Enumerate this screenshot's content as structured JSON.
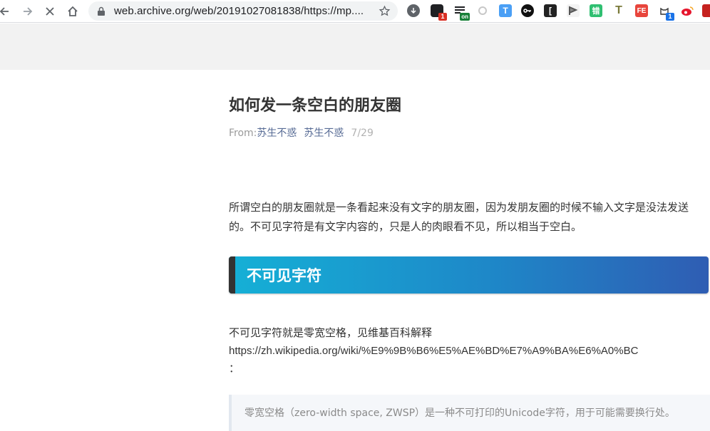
{
  "browser": {
    "url": "web.archive.org/web/20191027081838/https://mp....",
    "extensions": [
      {
        "name": "download",
        "color": "#5f6368"
      },
      {
        "name": "ext-badge-1",
        "color": "#202124",
        "badge": "1",
        "badge_color": "#d93025"
      },
      {
        "name": "ext-list-on",
        "color": "#202124",
        "badge": "on",
        "badge_color": "#188038"
      },
      {
        "name": "ext-gray",
        "color": "#bdbdbd"
      },
      {
        "name": "ext-T",
        "label": "T",
        "color": "#4a9ff5"
      },
      {
        "name": "ext-key",
        "color": "#111111"
      },
      {
        "name": "ext-bracket",
        "label": "[",
        "color": "#222222"
      },
      {
        "name": "ext-flag",
        "color": "#555555"
      },
      {
        "name": "ext-cuo",
        "label": "错",
        "color": "#2fbf71"
      },
      {
        "name": "ext-T2",
        "label": "T",
        "color": "#7a7a3a"
      },
      {
        "name": "ext-FE",
        "label": "FE",
        "color": "#e8453c"
      },
      {
        "name": "ext-cat",
        "color": "#ffffff",
        "badge": "1",
        "badge_color": "#1a73e8"
      },
      {
        "name": "ext-weibo",
        "color": "#e6162d"
      },
      {
        "name": "ext-red",
        "color": "#c5221f"
      }
    ]
  },
  "article": {
    "title": "如何发一条空白的朋友圈",
    "meta_from": "From:",
    "meta_from_author": "苏生不惑",
    "meta_author": "苏生不惑",
    "meta_date": "7/29",
    "para1": "所谓空白的朋友圈就是一条看起来没有文字的朋友圈，因为发朋友圈的时候不输入文字是没法发送的。不可见字符是有文字内容的，只是人的肉眼看不见，所以相当于空白。",
    "section_heading": "不可见字符",
    "para2_text": "不可见字符就是零宽空格，见维基百科解释",
    "para2_url": "https://zh.wikipedia.org/wiki/%E9%9B%B6%E5%AE%BD%E7%A9%BA%E6%A0%BC",
    "para2_colon": "：",
    "quote": "零宽空格（zero-width space, ZWSP）是一种不可打印的Unicode字符，用于可能需要换行处。"
  }
}
